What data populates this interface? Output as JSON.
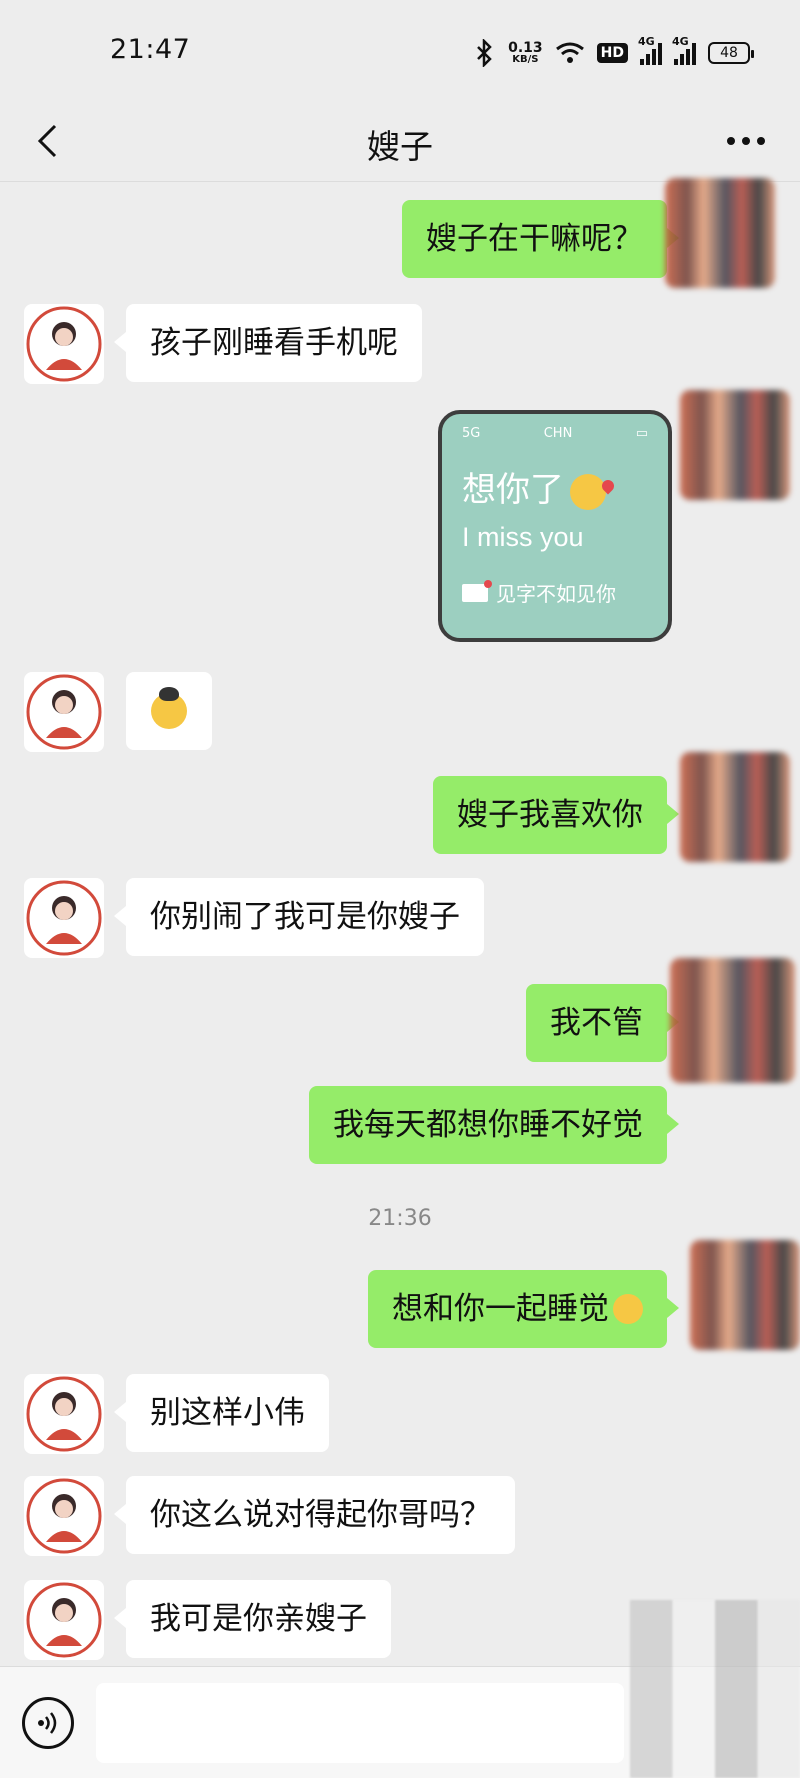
{
  "status_bar": {
    "time": "21:47",
    "net_speed_value": "0.13",
    "net_speed_unit": "KB/S",
    "hd_label": "HD",
    "sim1_label": "4G",
    "sim2_label": "4G",
    "battery_level": "48"
  },
  "nav": {
    "title": "嫂子"
  },
  "messages": [
    {
      "side": "out",
      "text": "嫂子在干嘛呢？"
    },
    {
      "side": "in",
      "text": "孩子刚睡看手机呢"
    },
    {
      "side": "out",
      "type": "image"
    },
    {
      "side": "in",
      "type": "sticker"
    },
    {
      "side": "out",
      "text": "嫂子我喜欢你"
    },
    {
      "side": "in",
      "text": "你别闹了我可是你嫂子"
    },
    {
      "side": "out",
      "text": "我不管"
    },
    {
      "side": "out",
      "text": "我每天都想你睡不好觉"
    },
    {
      "side": "out",
      "text": "想和你一起睡觉"
    },
    {
      "side": "in",
      "text": "别这样小伟"
    },
    {
      "side": "in",
      "text": "你这么说对得起你哥吗？"
    },
    {
      "side": "in",
      "text": "我可是你亲嫂子"
    }
  ],
  "image_card": {
    "status_signal": "5G",
    "status_carrier": "CHN",
    "title": "想你了",
    "subtitle": "I miss you",
    "footer": "见字不如见你"
  },
  "time_divider": "21:36",
  "input_bar": {
    "value": ""
  },
  "colors": {
    "background": "#ededed",
    "outgoing_bubble": "#95ec69",
    "incoming_bubble": "#ffffff",
    "image_card_bg": "#9ccfc0"
  }
}
